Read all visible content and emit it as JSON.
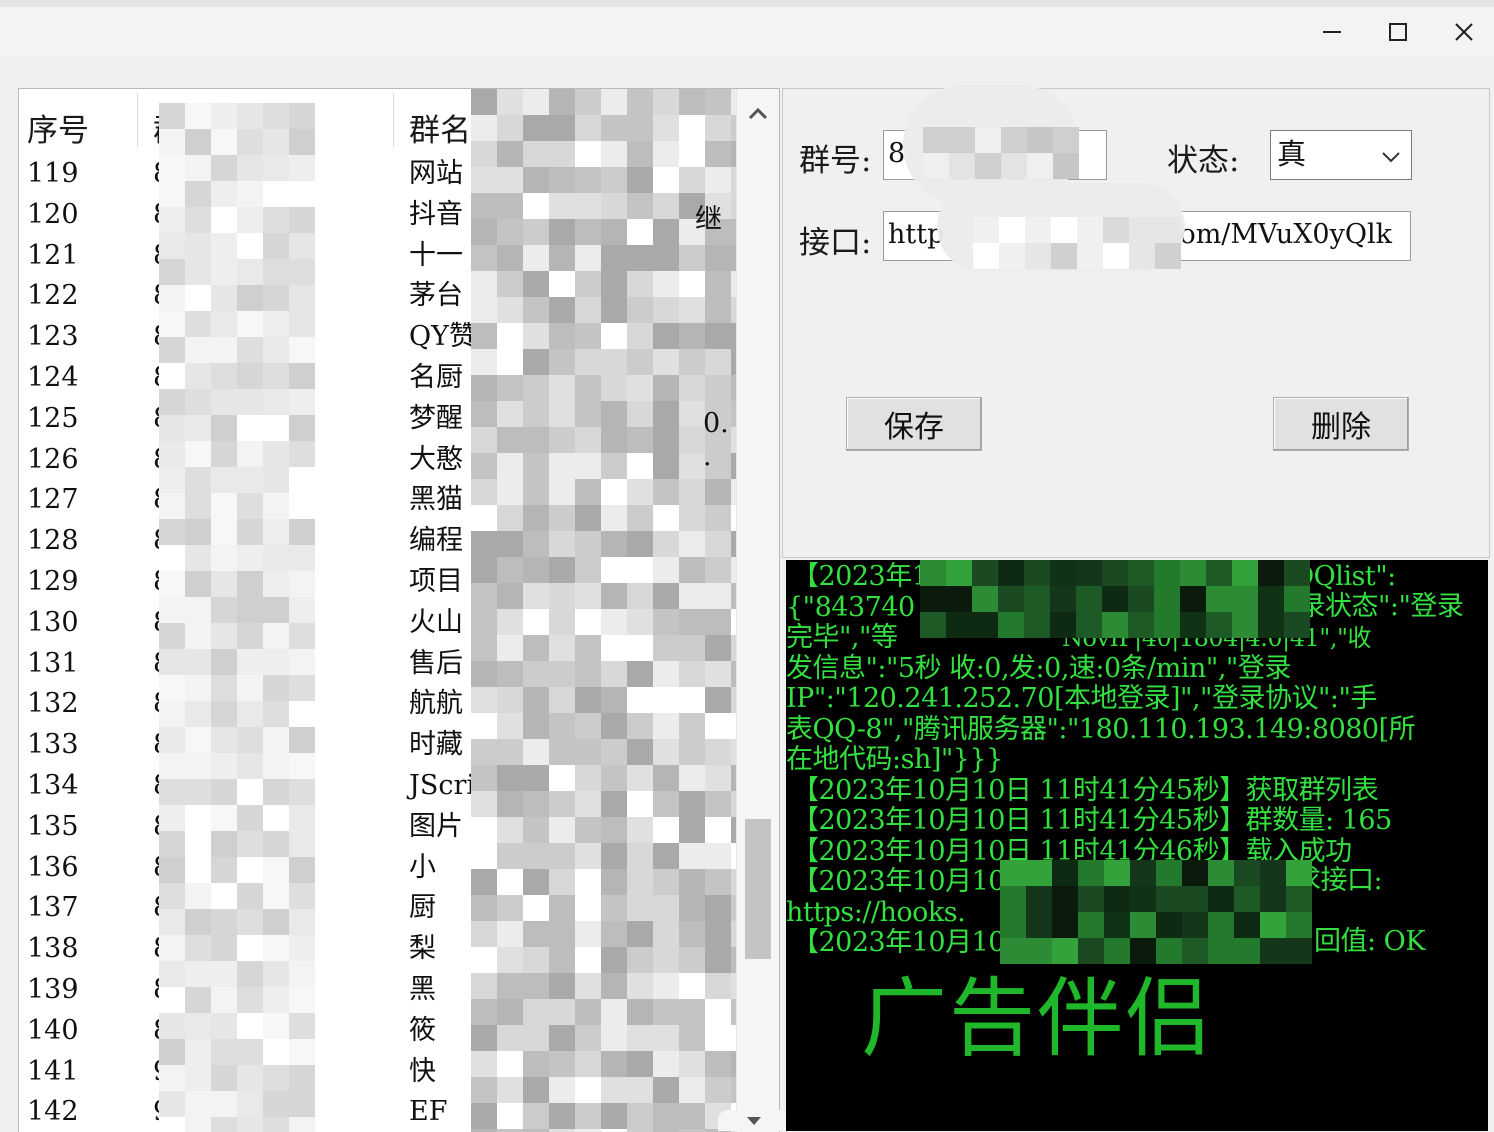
{
  "window_controls": {
    "minimize_icon": "minimize-icon",
    "maximize_icon": "maximize-icon",
    "close_icon": "close-icon"
  },
  "list": {
    "headers": [
      "序号",
      "群号",
      "群名"
    ],
    "rows": [
      {
        "index": "119",
        "group_id": "8",
        "group_name": "网站"
      },
      {
        "index": "120",
        "group_id": "8",
        "group_name": "抖音"
      },
      {
        "index": "121",
        "group_id": "8:",
        "group_name": "十一"
      },
      {
        "index": "122",
        "group_id": "8:",
        "group_name": "茅台"
      },
      {
        "index": "123",
        "group_id": "8",
        "group_name": "QY赞"
      },
      {
        "index": "124",
        "group_id": "83(",
        "group_name": "名厨"
      },
      {
        "index": "125",
        "group_id": "83",
        "group_name": "梦醒"
      },
      {
        "index": "126",
        "group_id": "8",
        "group_name": "大憨"
      },
      {
        "index": "127",
        "group_id": "8",
        "group_name": "黑猫"
      },
      {
        "index": "128",
        "group_id": "8",
        "group_name": "编程"
      },
      {
        "index": "129",
        "group_id": "8",
        "group_name": "项目"
      },
      {
        "index": "130",
        "group_id": "8",
        "group_name": "火山"
      },
      {
        "index": "131",
        "group_id": "8",
        "group_name": "售后"
      },
      {
        "index": "132",
        "group_id": "8",
        "group_name": "航航"
      },
      {
        "index": "133",
        "group_id": "8",
        "group_name": "时藏"
      },
      {
        "index": "134",
        "group_id": "8",
        "group_name": "JScri"
      },
      {
        "index": "135",
        "group_id": "87",
        "group_name": "图片"
      },
      {
        "index": "136",
        "group_id": "87",
        "group_name": "小"
      },
      {
        "index": "137",
        "group_id": "88",
        "group_name": "厨"
      },
      {
        "index": "138",
        "group_id": "88",
        "group_name": "梨"
      },
      {
        "index": "139",
        "group_id": "89",
        "group_name": "黑"
      },
      {
        "index": "140",
        "group_id": "89",
        "group_name": "筱"
      },
      {
        "index": "141",
        "group_id": "90",
        "group_name": "快"
      },
      {
        "index": "142",
        "group_id": "90",
        "group_name": "EF"
      }
    ],
    "edge_fragments": {
      "row120": "继",
      "row125": "0.",
      "row126": "·"
    }
  },
  "form": {
    "group_label": "群号:",
    "group_value": "8",
    "status_label": "状态:",
    "status_value": "真",
    "api_label": "接口:",
    "api_value_start": "http",
    "api_value_end": "com/MVuX0yQlk",
    "save_label": "保存",
    "delete_label": "删除"
  },
  "console": {
    "lines": [
      "【2023年1",
      "{\"843740",
      "完毕\",\"等",
      "发信息\":\"5秒 收:0,发:0,速:0条/min\",\"登录",
      "IP\":\"120.241.252.70[本地登录]\",\"登录协议\":\"手",
      "表QQ-8\",\"腾讯服务器\":\"180.110.193.149:8080[所",
      "在地代码:sh]\"}}}",
      "【2023年10月10日 11时41分45秒】获取群列表",
      "【2023年10月10日 11时41分45秒】群数量: 165",
      "【2023年10月10日 11时41分46秒】载入成功",
      "【2023年10月10",
      "https://hooks.",
      "【2023年10月10"
    ],
    "line_tails": {
      "line0": "QQlist\":",
      "line1": "登录状态\":\"登录",
      "line2": "NovIP|40|1804|4.0|41\",\"收",
      "line10": "求接口:",
      "line12": "回值: OK"
    },
    "watermark": "广告伴侣"
  },
  "colors": {
    "console_bg": "#000000",
    "console_text": "#33e040",
    "watermark": "#1fb82a",
    "window_bg": "#f0f0f0"
  }
}
